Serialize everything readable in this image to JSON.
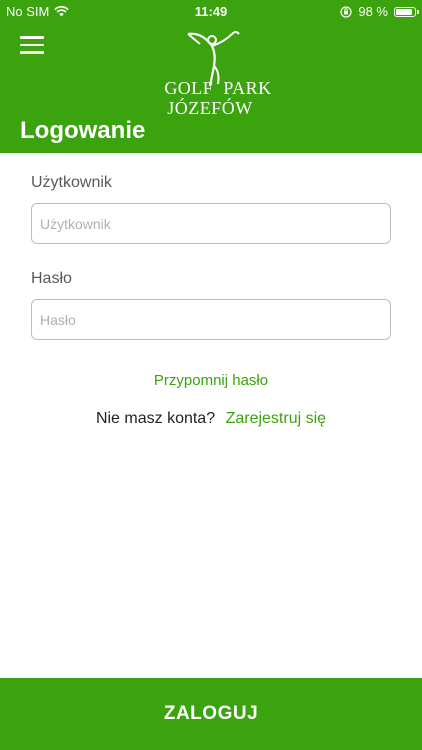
{
  "status_bar": {
    "carrier": "No SIM",
    "time": "11:49",
    "battery": "98 %",
    "battery_level": 0.98
  },
  "header": {
    "menu_icon": "hamburger-menu-icon",
    "logo": {
      "line1": "GOLF  PARK",
      "line2": "JÓZEFÓW"
    },
    "title": "Logowanie"
  },
  "form": {
    "username": {
      "label": "Użytkownik",
      "placeholder": "Użytkownik",
      "value": ""
    },
    "password": {
      "label": "Hasło",
      "placeholder": "Hasło",
      "value": ""
    }
  },
  "links": {
    "forgot_password": "Przypomnij hasło",
    "no_account_text": "Nie masz konta?",
    "register": "Zarejestruj się"
  },
  "login_button": "ZALOGUJ",
  "colors": {
    "brand_green": "#3aa30e",
    "label_gray": "#5a5a5a",
    "input_border": "#bdbdbd"
  }
}
